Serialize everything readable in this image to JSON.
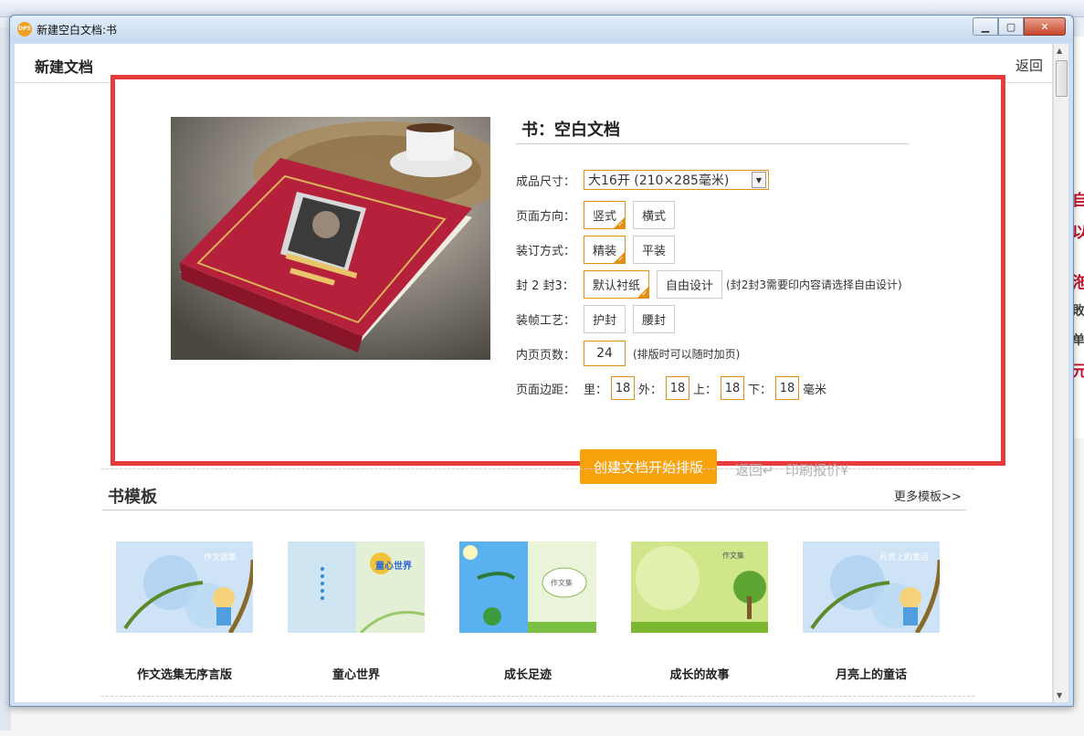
{
  "window": {
    "title": "新建空白文档:书",
    "icon_text": "DPS"
  },
  "header": {
    "title": "新建文档",
    "back": "返回"
  },
  "form": {
    "title": "书：空白文档",
    "size_label": "成品尺寸：",
    "size_value": "大16开 (210×285毫米)",
    "orientation_label": "页面方向：",
    "orientation_options": [
      "竖式",
      "横式"
    ],
    "binding_label": "装订方式：",
    "binding_options": [
      "精装",
      "平装"
    ],
    "cover_label": "封 2 封3：",
    "cover_options": [
      "默认衬纸",
      "自由设计"
    ],
    "cover_hint": "(封2封3需要印内容请选择自由设计)",
    "craft_label": "装帧工艺：",
    "craft_options": [
      "护封",
      "腰封"
    ],
    "pages_label": "内页页数：",
    "pages_value": "24",
    "pages_hint": "(排版时可以随时加页)",
    "margin_label": "页面边距：",
    "margins": {
      "inner_label": "里：",
      "inner": "18",
      "outer_label": "外：",
      "outer": "18",
      "top_label": "上：",
      "top": "18",
      "bottom_label": "下：",
      "bottom": "18",
      "unit": "毫米"
    },
    "create_button": "创建文档开始排版",
    "back_link": "返回↵",
    "quote_link": "印刷报价¥"
  },
  "templates": {
    "title": "书模板",
    "more": "更多模板>>",
    "items": [
      {
        "name": "作文选集无序言版",
        "cover_text": "作文选集"
      },
      {
        "name": "童心世界",
        "cover_text": "童心世界"
      },
      {
        "name": "成长足迹",
        "cover_text": "作文集"
      },
      {
        "name": "成长的故事",
        "cover_text": "作文集"
      },
      {
        "name": "月亮上的童话",
        "cover_text": "月亮上的童话"
      }
    ]
  },
  "background": {
    "right_chars": [
      "自",
      "以",
      "沲",
      "敗",
      "单",
      "元"
    ]
  },
  "colors": {
    "accent": "#f7a20b",
    "frame": "#e83c3c",
    "selected_border": "#e48f13"
  }
}
